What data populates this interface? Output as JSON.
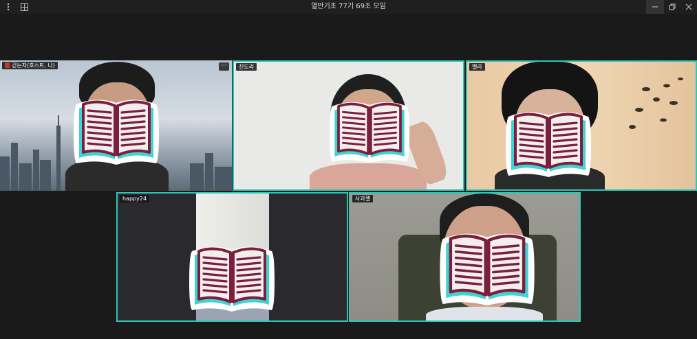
{
  "window": {
    "title": "열반기초 77기 69조 모임",
    "controls": {
      "menu_icon": "vertical-ellipsis-icon",
      "layout_icon": "grid-layout-icon",
      "minimize_icon": "minimize-icon",
      "restore_icon": "restore-icon",
      "close_icon": "close-icon"
    }
  },
  "participants": [
    {
      "name": "걷는자(호스트, 나)",
      "host_badge_icon": "host-icon",
      "has_more_menu": true,
      "more_label": "···",
      "active_speaker": false,
      "face_sticker": "open-book-icon"
    },
    {
      "name": "진도리",
      "active_speaker": true,
      "face_sticker": "open-book-icon"
    },
    {
      "name": "벨라",
      "active_speaker": true,
      "face_sticker": "open-book-icon"
    },
    {
      "name": "happy24",
      "active_speaker": true,
      "face_sticker": "open-book-icon"
    },
    {
      "name": "사과젤",
      "active_speaker": true,
      "face_sticker": "open-book-icon"
    }
  ],
  "colors": {
    "background": "#1a1a1a",
    "active_border": "#2bc6b6",
    "sticker_outline": "#7a1f3d",
    "sticker_accent": "#3fd3d3"
  }
}
